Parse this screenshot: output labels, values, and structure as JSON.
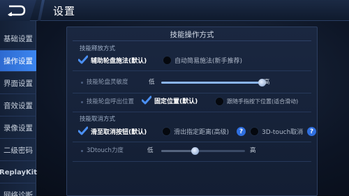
{
  "header": {
    "title": "设置",
    "back_icon": "back-arrow-icon"
  },
  "sidebar": {
    "items": [
      {
        "label": "基础设置",
        "active": false
      },
      {
        "label": "操作设置",
        "active": true
      },
      {
        "label": "界面设置",
        "active": false
      },
      {
        "label": "音效设置",
        "active": false
      },
      {
        "label": "录像设置",
        "active": false
      },
      {
        "label": "二级密码",
        "active": false
      },
      {
        "label": "ReplayKit",
        "active": false
      },
      {
        "label": "网络诊断",
        "active": false
      }
    ]
  },
  "panel": {
    "title": "技能操作方式",
    "release_section": {
      "title": "技能释放方式",
      "options": [
        {
          "label": "辅助轮盘施法(默认)",
          "checked": true
        },
        {
          "label": "自动简易施法(新手推荐)",
          "checked": false
        }
      ]
    },
    "wheel_sensitivity": {
      "label": "技能轮盘灵敏度",
      "low": "低",
      "high": "高",
      "value_fraction": 0.95
    },
    "wheel_position": {
      "label": "技能轮盘呼出位置",
      "options": [
        {
          "label": "固定位置(默认)",
          "checked": true
        },
        {
          "label": "跟随手指按下位置(适合滑动)",
          "checked": false
        }
      ]
    },
    "cancel_section": {
      "title": "技能取消方式",
      "options": [
        {
          "label": "滑至取消按钮(默认)",
          "checked": true
        },
        {
          "label": "滑出指定距离(高级)",
          "checked": false,
          "help": "?"
        },
        {
          "label": "3D-touch取消",
          "checked": false,
          "help": "?"
        }
      ]
    },
    "touch_strength": {
      "label": "3Dtouch力度",
      "low": "低",
      "high": "高",
      "value_fraction": 0.4
    }
  },
  "colors": {
    "accent": "#3c86f0",
    "check": "#4b90f5",
    "background": "#0b1320"
  }
}
